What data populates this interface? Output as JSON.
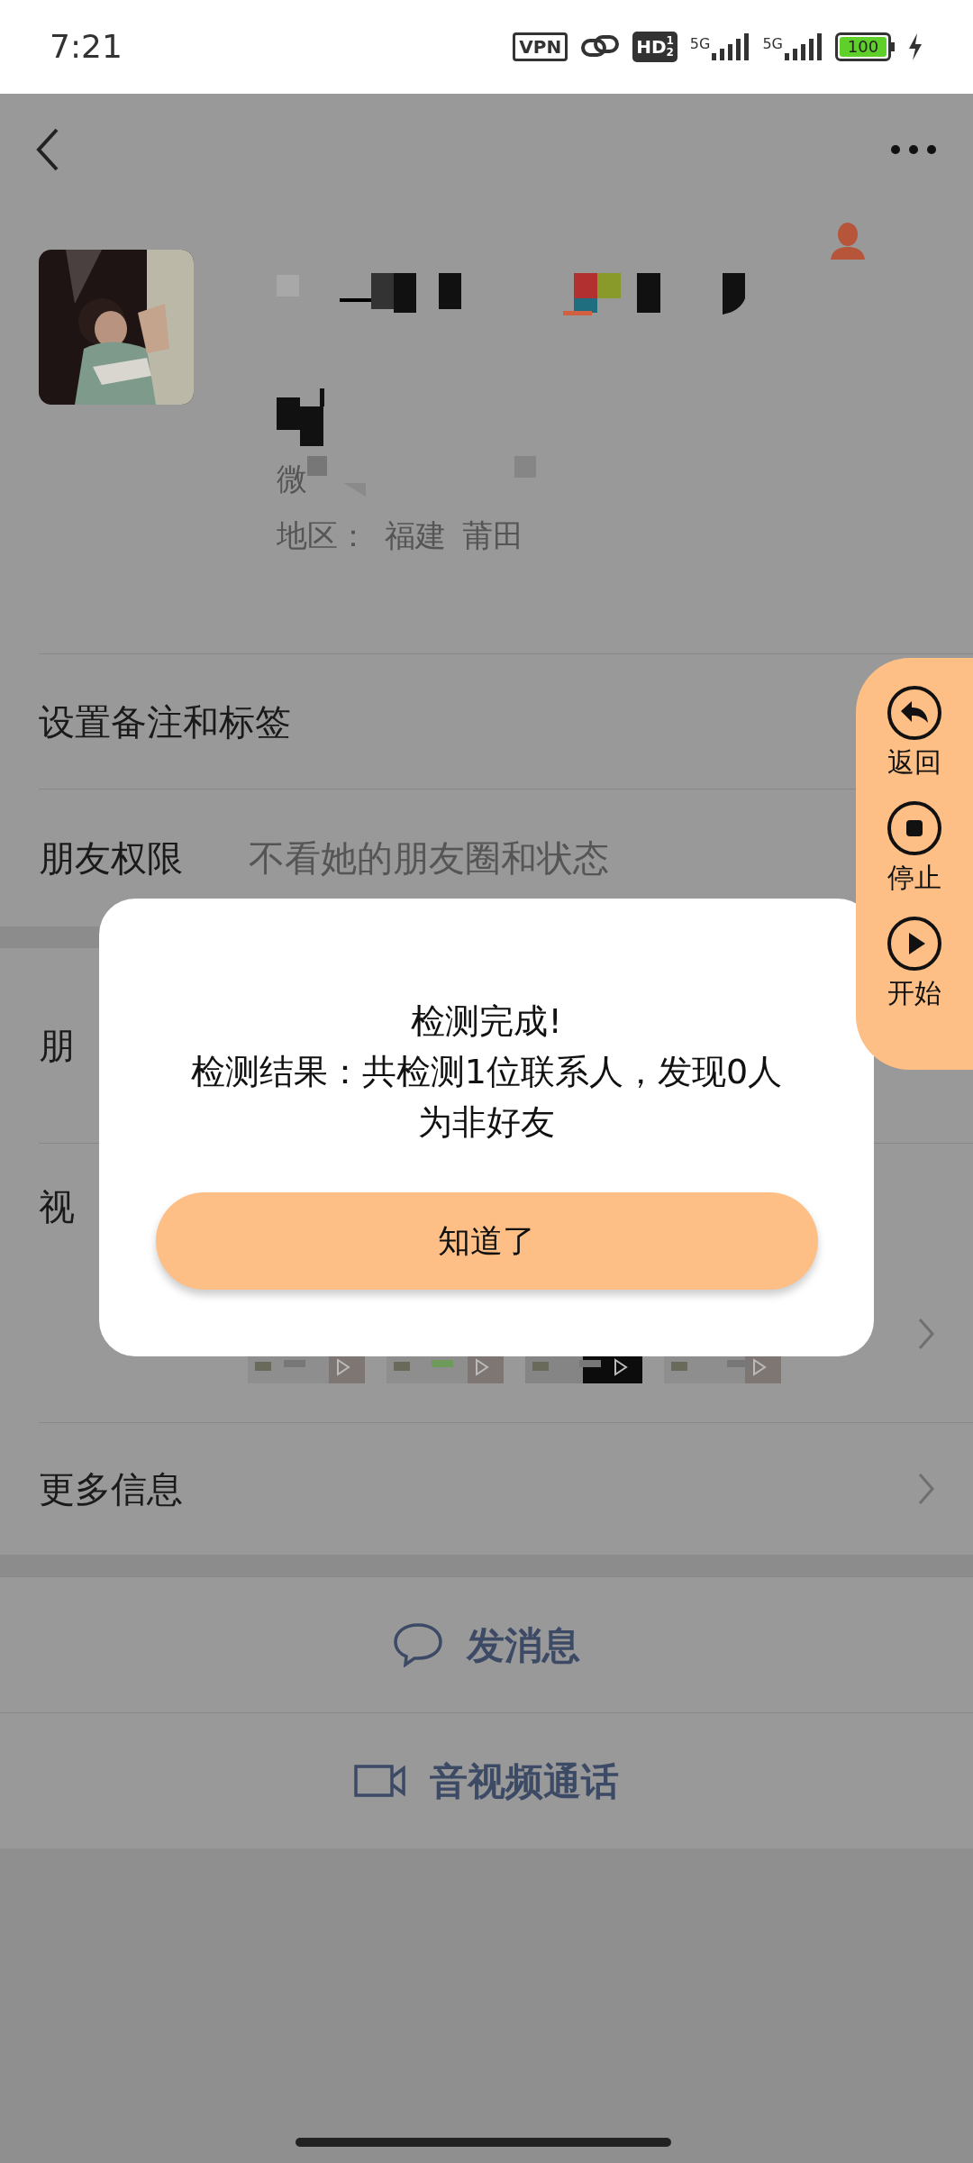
{
  "status_bar": {
    "time": "7:21",
    "vpn": "VPN",
    "hd": "HD",
    "hd_sup": "1",
    "hd_sub": "2",
    "network_1": "5G",
    "network_2": "5G",
    "battery": "100"
  },
  "profile": {
    "wechat_id_label": "微",
    "region_label": "地区：",
    "province": "福建",
    "city": "莆田"
  },
  "rows": [
    {
      "kind": "plain",
      "label": "设置备注和标签"
    },
    {
      "kind": "value",
      "label": "朋友权限",
      "value": "不看她的朋友圈和状态"
    },
    {
      "kind": "gap"
    },
    {
      "kind": "covered",
      "label": "朋"
    },
    {
      "kind": "media",
      "label": "视"
    },
    {
      "kind": "link",
      "label": "更多信息"
    },
    {
      "kind": "gap"
    },
    {
      "kind": "message",
      "label": "发消息"
    },
    {
      "kind": "call",
      "label": "音视频通话"
    }
  ],
  "float_panel": [
    {
      "kind": "back",
      "label": "返回"
    },
    {
      "kind": "stop",
      "label": "停止"
    },
    {
      "kind": "play",
      "label": "开始"
    }
  ],
  "dialog": {
    "title": "检测完成!",
    "message": "检测结果：共检测1位联系人，发现0人为非好友",
    "button": "知道了"
  }
}
